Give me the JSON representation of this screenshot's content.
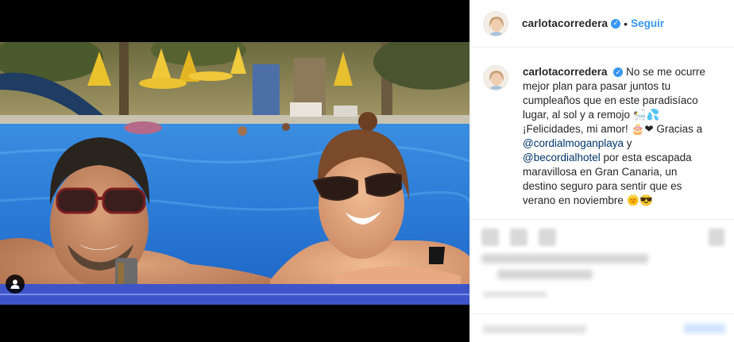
{
  "header": {
    "username": "carlotacorredera",
    "follow_label": "Seguir",
    "separator": "•"
  },
  "caption": {
    "username": "carlotacorredera",
    "text_1": "No se me ocurre mejor plan para pasar juntos tu cumpleaños que en este paradisíaco lugar, al sol y a remojo 🛀💦 ¡Felicidades, mi amor! 🎂❤ Gracias a ",
    "mention_1": "@cordialmoganplaya",
    "text_2": " y ",
    "mention_2": "@becordialhotel",
    "text_3": " por esta escapada maravillosa en Gran Canaria, un destino seguro para sentir que es verano en noviembre 🌞😎"
  },
  "icons": {
    "verified": "verified-badge-icon",
    "user_tag": "user-tag-icon",
    "like": "heart-icon",
    "comment": "comment-icon",
    "share": "share-icon",
    "save": "bookmark-icon"
  },
  "colors": {
    "accent": "#3897f0",
    "mention": "#003569",
    "text": "#262626"
  }
}
